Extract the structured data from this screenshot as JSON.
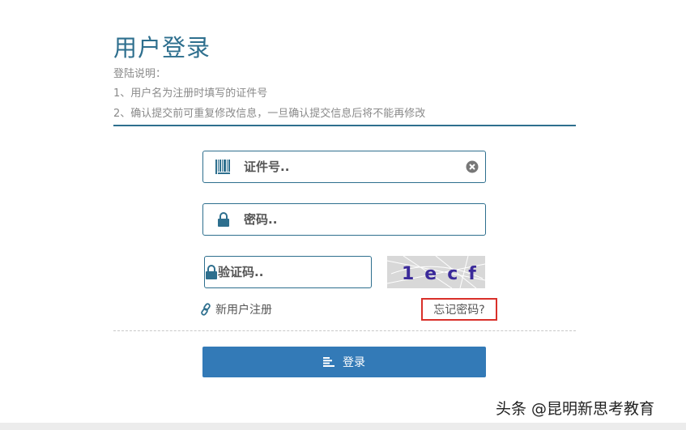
{
  "login": {
    "title": "用户登录",
    "notes": [
      "登陆说明：",
      "1、用户名为注册时填写的证件号",
      "2、确认提交前可重复修改信息，一旦确认提交信息后将不能再修改"
    ],
    "id_placeholder": "证件号..",
    "password_placeholder": "密码..",
    "captcha_placeholder": "验证码..",
    "captcha_text": "1ecf",
    "register_label": "新用户注册",
    "forgot_label": "忘记密码?",
    "submit_label": "登录"
  },
  "watermark": "头条 @昆明新思考教育",
  "colors": {
    "accent": "#2e6f8e",
    "button": "#337ab7",
    "highlight": "#d9302a"
  },
  "icons": [
    "barcode-icon",
    "clear-icon",
    "lock-icon",
    "link-icon",
    "list-icon"
  ]
}
